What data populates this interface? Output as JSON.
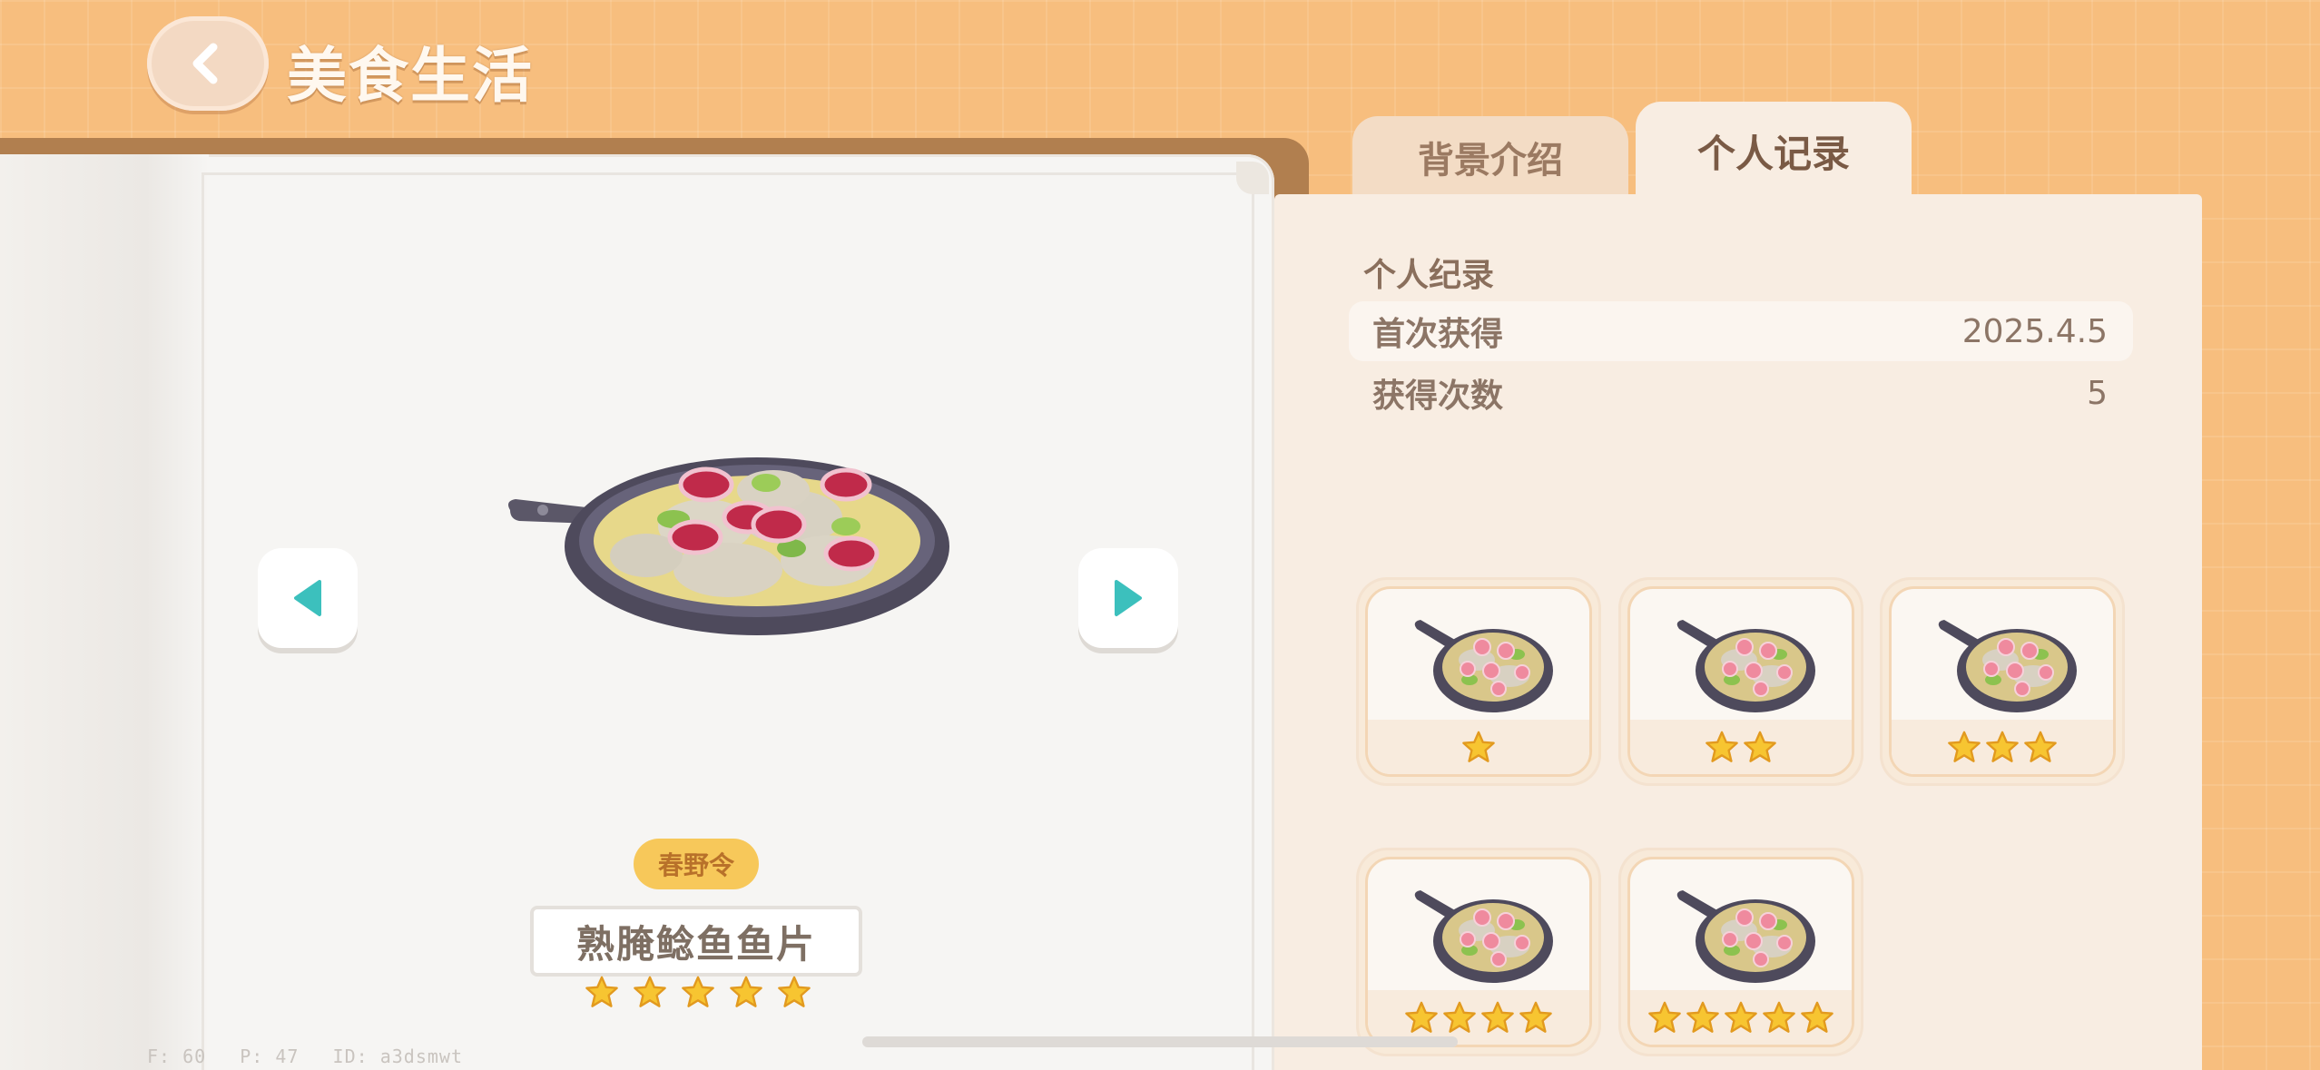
{
  "header": {
    "title": "美食生活"
  },
  "tabs": [
    {
      "label": "背景介绍",
      "active": false
    },
    {
      "label": "个人记录",
      "active": true
    }
  ],
  "dish": {
    "season": "春野令",
    "name": "熟腌鲶鱼鱼片",
    "stars": 5
  },
  "record": {
    "heading": "个人纪录",
    "rows": [
      {
        "label": "首次获得",
        "value": "2025.4.5"
      },
      {
        "label": "获得次数",
        "value": "5"
      }
    ]
  },
  "variants": [
    {
      "stars": 1
    },
    {
      "stars": 2
    },
    {
      "stars": 3
    },
    {
      "stars": 4
    },
    {
      "stars": 5
    }
  ],
  "debug": {
    "f": "F: 60",
    "p": "P: 47",
    "id": "ID: a3dsmwt"
  },
  "colors": {
    "background": "#f7be7e",
    "star": "#f7c531",
    "nav_arrow": "#3cc0bd",
    "season_badge": "#f7c85a"
  },
  "icons": {
    "back": "chevron-left-icon",
    "prev": "triangle-left-icon",
    "next": "triangle-right-icon",
    "star": "star-icon"
  }
}
